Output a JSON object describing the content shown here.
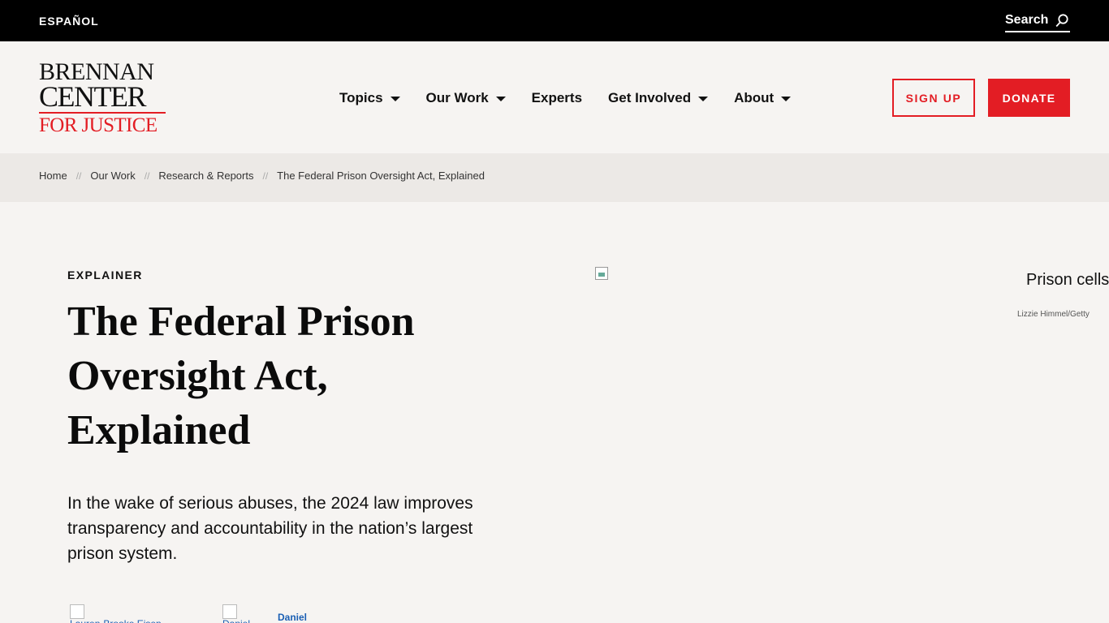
{
  "topbar": {
    "language_link": "ESPAÑOL",
    "search_label": "Search",
    "search_icon": "search-icon"
  },
  "logo": {
    "line1": "BRENNAN",
    "line2": "CENTER",
    "line3": "FOR JUSTICE"
  },
  "nav": {
    "items": [
      {
        "label": "Topics",
        "has_dropdown": true
      },
      {
        "label": "Our Work",
        "has_dropdown": true
      },
      {
        "label": "Experts",
        "has_dropdown": false
      },
      {
        "label": "Get Involved",
        "has_dropdown": true
      },
      {
        "label": "About",
        "has_dropdown": true
      }
    ],
    "signup_label": "SIGN UP",
    "donate_label": "DONATE"
  },
  "breadcrumb": {
    "items": [
      "Home",
      "Our Work",
      "Research & Reports",
      "The Federal Prison Oversight Act, Explained"
    ],
    "separator": "//"
  },
  "article": {
    "kicker": "EXPLAINER",
    "title": "The Federal Prison Oversight Act, Explained",
    "dek": "In the wake of serious abuses, the 2024 law improves transparency and accountability in the nation’s largest prison system."
  },
  "hero_image": {
    "alt": "Prison cells",
    "credit": "Lizzie Himmel/Getty"
  },
  "authors": {
    "author1_alt": "Lauren-Brooke Eisen",
    "author2_alt": "Daniel",
    "author2_name": "Daniel"
  },
  "colors": {
    "brand_red": "#e31d24",
    "topbar": "#000000",
    "page_bg": "#f6f4f2",
    "breadcrumb_bg": "#ece9e6",
    "link_blue": "#1a5fb4"
  }
}
